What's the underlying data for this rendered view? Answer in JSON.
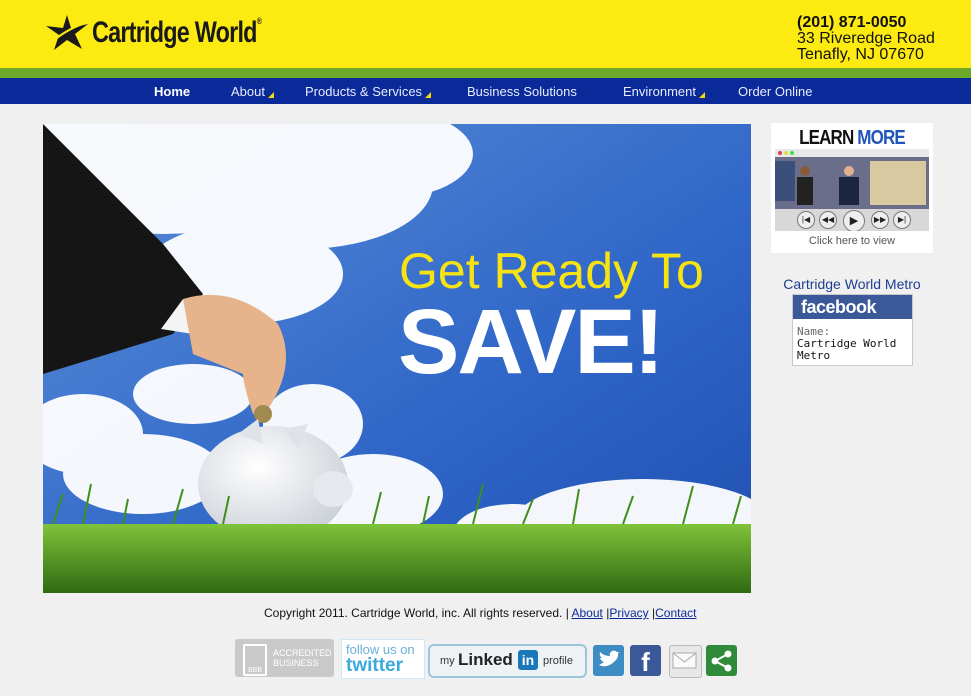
{
  "header": {
    "logo_text": "Cartridge World",
    "logo_reg": "®",
    "phone": "(201) 871-0050",
    "address_line1": "33 Riveredge Road",
    "address_line2": "Tenafly, NJ 07670"
  },
  "nav": {
    "items": [
      {
        "label": "Home"
      },
      {
        "label": "About"
      },
      {
        "label": "Products & Services"
      },
      {
        "label": "Business Solutions"
      },
      {
        "label": "Environment"
      },
      {
        "label": "Order Online"
      }
    ]
  },
  "hero": {
    "line1": "Get Ready To",
    "line2": "SAVE!"
  },
  "learn_more": {
    "title_part1": "LEARN",
    "title_part2": "MORE",
    "caption": "Click here to view"
  },
  "facebook": {
    "title": "Cartridge World Metro",
    "brand": "facebook",
    "name_label": "Name:",
    "name_line1": "Cartridge World",
    "name_line2": "Metro"
  },
  "footer": {
    "copyright": "Copyright 2011. Cartridge World, inc. All rights reserved. |",
    "link_about": "About",
    "sep1": "|",
    "link_privacy": "Privacy",
    "sep2": "|",
    "link_contact": "Contact"
  },
  "badges": {
    "bbb_small": "BBB",
    "bbb_line1": "ACCREDITED",
    "bbb_line2": "BUSINESS",
    "twitter_follow": "follow us on",
    "twitter_brand": "twitter",
    "linkedin_my": "my",
    "linkedin_brand": "Linked",
    "linkedin_in": "in",
    "linkedin_profile": "profile",
    "facebook_f": "f"
  },
  "colors": {
    "header_yellow": "#fcea10",
    "green_bar": "#6ca92b",
    "nav_blue": "#0a2a9a",
    "facebook_blue": "#3b5998"
  }
}
